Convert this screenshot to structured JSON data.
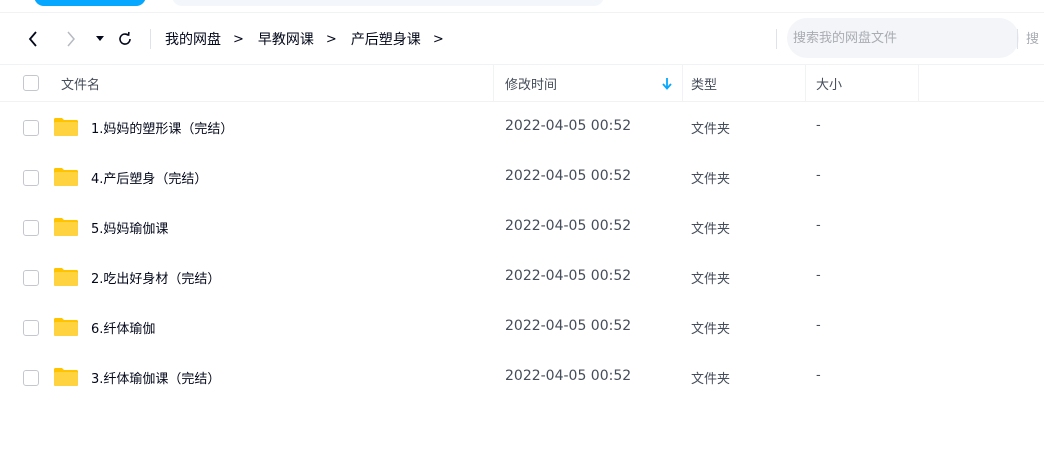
{
  "colors": {
    "accent": "#06a7ff",
    "folder": "#ffc300",
    "text_primary": "#03081a",
    "text_secondary": "#454d5a",
    "placeholder": "#a9acb3"
  },
  "toolbar": {
    "back_icon": "chevron-left-icon",
    "forward_icon": "chevron-right-icon",
    "dropdown_icon": "caret-down-icon",
    "refresh_icon": "refresh-icon",
    "breadcrumb": [
      {
        "label": "我的网盘"
      },
      {
        "label": "早教网课"
      },
      {
        "label": "产后塑身课"
      }
    ],
    "breadcrumb_separator": ">",
    "search": {
      "placeholder": "搜索我的网盘文件",
      "button_label": "搜"
    }
  },
  "table": {
    "columns": {
      "name": "文件名",
      "modified": "修改时间",
      "type": "类型",
      "size": "大小"
    },
    "sort_icon": "arrow-down-icon",
    "rows": [
      {
        "name": "1.妈妈的塑形课（完结）",
        "modified": "2022-04-05 00:52",
        "type": "文件夹",
        "size": "-"
      },
      {
        "name": "4.产后塑身（完结）",
        "modified": "2022-04-05 00:52",
        "type": "文件夹",
        "size": "-"
      },
      {
        "name": "5.妈妈瑜伽课",
        "modified": "2022-04-05 00:52",
        "type": "文件夹",
        "size": "-"
      },
      {
        "name": "2.吃出好身材（完结）",
        "modified": "2022-04-05 00:52",
        "type": "文件夹",
        "size": "-"
      },
      {
        "name": "6.纤体瑜伽",
        "modified": "2022-04-05 00:52",
        "type": "文件夹",
        "size": "-"
      },
      {
        "name": "3.纤体瑜伽课（完结）",
        "modified": "2022-04-05 00:52",
        "type": "文件夹",
        "size": "-"
      }
    ]
  }
}
